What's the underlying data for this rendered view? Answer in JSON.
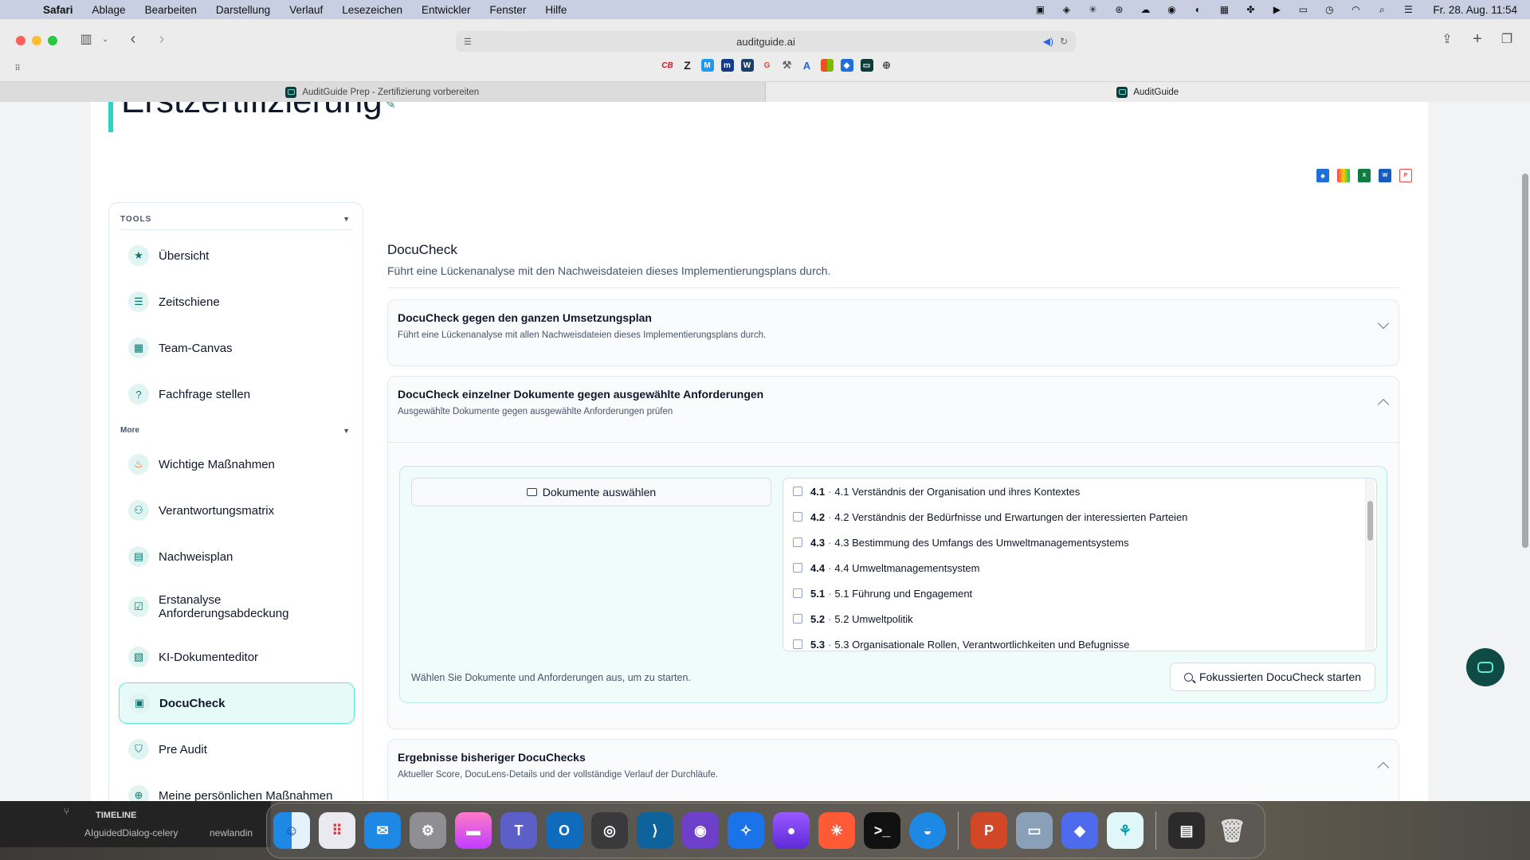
{
  "menubar": {
    "items": [
      "Safari",
      "Ablage",
      "Bearbeiten",
      "Darstellung",
      "Verlauf",
      "Lesezeichen",
      "Entwickler",
      "Fenster",
      "Hilfe"
    ],
    "clock": "Fr. 28. Aug. 11:54"
  },
  "browser": {
    "url": "auditguide.ai",
    "tabs": [
      "AuditGuide Prep - Zertifizierung vorbereiten",
      "AuditGuide"
    ]
  },
  "page": {
    "title": "Erstzertifizierung"
  },
  "sidebar": {
    "tools_heading": "TOOLS",
    "more_heading": "More",
    "tools": [
      {
        "label": "Übersicht",
        "icon": "star-icon"
      },
      {
        "label": "Zeitschiene",
        "icon": "timeline-icon"
      },
      {
        "label": "Team-Canvas",
        "icon": "canvas-icon"
      },
      {
        "label": "Fachfrage stellen",
        "icon": "question-icon"
      }
    ],
    "more": [
      {
        "label": "Wichtige Maßnahmen",
        "icon": "flame-icon"
      },
      {
        "label": "Verantwortungsmatrix",
        "icon": "people-icon"
      },
      {
        "label": "Nachweisplan",
        "icon": "document-icon"
      },
      {
        "label": "Erstanalyse Anforderungsabdeckung",
        "icon": "clipboard-icon"
      },
      {
        "label": "KI-Dokumenteditor",
        "icon": "ai-document-icon"
      },
      {
        "label": "DocuCheck",
        "icon": "doc-search-icon"
      },
      {
        "label": "Pre Audit",
        "icon": "shield-icon"
      },
      {
        "label": "Meine persönlichen Maßnahmen",
        "icon": "plus-circle-icon"
      }
    ],
    "active": "DocuCheck"
  },
  "docucheck": {
    "title": "DocuCheck",
    "subtitle": "Führt eine Lückenanalyse mit den Nachweisdateien dieses Implementierungsplans durch.",
    "accordions": [
      {
        "title": "DocuCheck gegen den ganzen Umsetzungsplan",
        "subtitle": "Führt eine Lückenanalyse mit allen Nachweisdateien dieses Implementierungsplans durch.",
        "expanded": false
      },
      {
        "title": "DocuCheck einzelner Dokumente gegen ausgewählte Anforderungen",
        "subtitle": "Ausgewählte Dokumente gegen ausgewählte Anforderungen prüfen",
        "expanded": true
      },
      {
        "title": "Ergebnisse bisheriger DocuChecks",
        "subtitle": "Aktueller Score, DocuLens-Details und der vollständige Verlauf der Durchläufe.",
        "expanded": true
      }
    ],
    "select_documents_label": "Dokumente auswählen",
    "requirements": [
      {
        "num": "4.1",
        "text": "4.1 Verständnis der Organisation und ihres Kontextes"
      },
      {
        "num": "4.2",
        "text": "4.2 Verständnis der Bedürfnisse und Erwartungen der interessierten Parteien"
      },
      {
        "num": "4.3",
        "text": "4.3 Bestimmung des Umfangs des Umweltmanagementsystems"
      },
      {
        "num": "4.4",
        "text": "4.4 Umweltmanagementsystem"
      },
      {
        "num": "5.1",
        "text": "5.1 Führung und Engagement"
      },
      {
        "num": "5.2",
        "text": "5.2 Umweltpolitik"
      },
      {
        "num": "5.3",
        "text": "5.3 Organisationale Rollen, Verantwortlichkeiten und Befugnisse"
      }
    ],
    "separator": "·",
    "hint": "Wählen Sie Dokumente und Anforderungen aus, um zu starten.",
    "start_button": "Fokussierten DocuCheck starten"
  },
  "terminal": {
    "heading": "TIMELINE",
    "branch": "AIguidedDialog-celery",
    "branch2": "newlandin"
  },
  "colors": {
    "accent": "#2dd4bf",
    "active_bg": "#e6fbf8",
    "fab": "#0f4a44"
  }
}
